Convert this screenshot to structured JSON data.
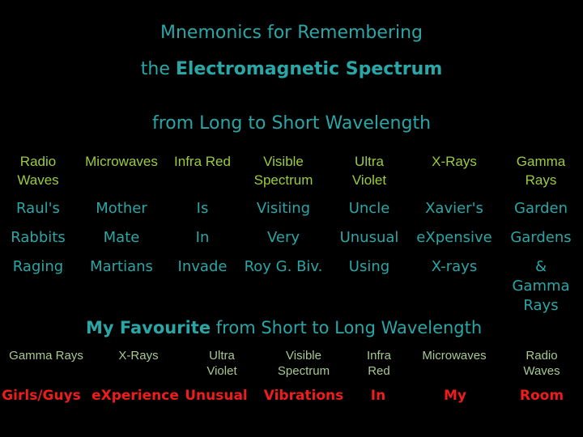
{
  "title": {
    "line1": "Mnemonics for Remembering",
    "line2_prefix": "the",
    "line2_bold": "Electromagnetic Spectrum",
    "subtitle": "from Long to Short Wavelength"
  },
  "long_to_short": {
    "headers": [
      "Radio\nWaves",
      "Microwaves",
      "Infra Red",
      "Visible\nSpectrum",
      "Ultra\nViolet",
      "X-Rays",
      "Gamma\nRays"
    ],
    "mnemonics": [
      [
        "Raul's",
        "Mother",
        "Is",
        "Visiting",
        "Uncle",
        "Xavier's",
        "Garden"
      ],
      [
        "Rabbits",
        "Mate",
        "In",
        "Very",
        "Unusual",
        "eXpensive",
        "Gardens"
      ],
      [
        "Raging",
        "Martians",
        "Invade",
        "Roy G. Biv.",
        "Using",
        "X-rays",
        "& Gamma\nRays"
      ]
    ]
  },
  "favourite": {
    "title_bold": "My Favourite",
    "title_rest": "from Short to Long Wavelength",
    "headers": [
      "Gamma Rays",
      "X-Rays",
      "Ultra\nViolet",
      "Visible\nSpectrum",
      "Infra\nRed",
      "Microwaves",
      "Radio\nWaves"
    ],
    "mnemonic": [
      "Girls/Guys",
      "eXperience",
      "Unusual",
      "Vibrations",
      "In",
      "My",
      "Room"
    ]
  },
  "colors": {
    "background": "#000000",
    "title": "#2aa6a6",
    "headers": "#9ccc3c",
    "favourite_headers": "#a8c890",
    "favourite_mnemonic": "#ee1c1c"
  }
}
